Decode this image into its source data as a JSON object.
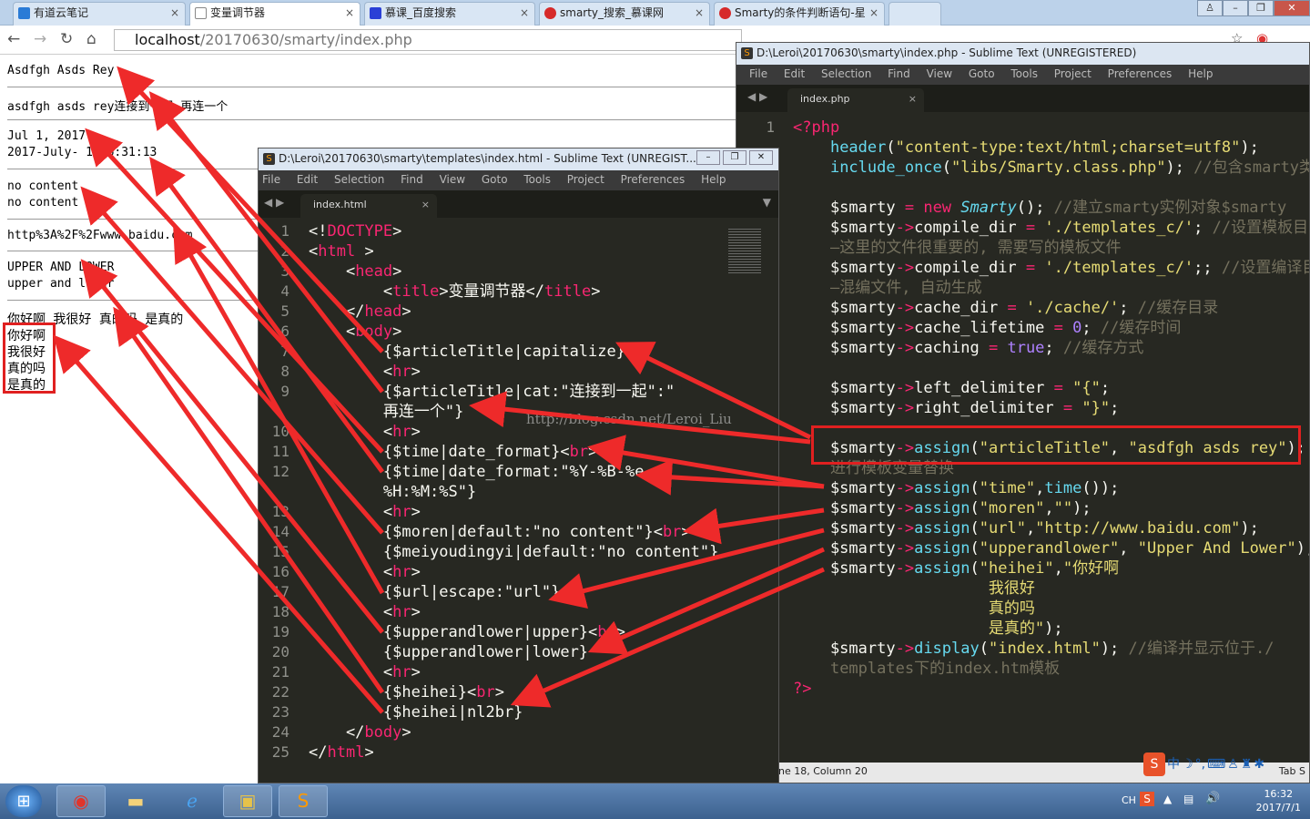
{
  "browser": {
    "tabs": [
      {
        "label": "有道云笔记",
        "color": "#2a7bd6"
      },
      {
        "label": "变量调节器",
        "color": "#ffffff"
      },
      {
        "label": "慕课_百度搜索",
        "color": "#2a3fd6"
      },
      {
        "label": "smarty_搜索_慕课网",
        "color": "#d62a2a"
      },
      {
        "label": "Smarty的条件判断语句-星",
        "color": "#d62a2a"
      }
    ],
    "url_host": "localhost",
    "url_path": "/20170630/smarty/index.php"
  },
  "page": {
    "lines": [
      "Asdfgh Asds Rey",
      "asdfgh asds rey连接到一起 再连一个",
      "Jul 1, 2017",
      "2017-July- 1 16:31:13",
      "no content",
      "no content",
      "http%3A%2F%2Fwww.baidu.com",
      "UPPER AND LOWER",
      "upper and lower",
      "你好啊 我很好 真的吗 是真的",
      "你好啊",
      "我很好",
      "真的吗",
      "是真的"
    ]
  },
  "editor_html": {
    "title": "D:\\Leroi\\20170630\\smarty\\templates\\index.html - Sublime Text (UNREGIST...",
    "menu": [
      "File",
      "Edit",
      "Selection",
      "Find",
      "View",
      "Goto",
      "Tools",
      "Project",
      "Preferences",
      "Help"
    ],
    "tab": "index.html",
    "tab_close": "×",
    "line_numbers": "1\n2\n3\n4\n5\n6\n7\n8\n9\n\n10\n11\n12\n\n13\n14\n15\n16\n17\n18\n19\n20\n21\n22\n23\n24\n25"
  },
  "editor_php": {
    "title": "D:\\Leroi\\20170630\\smarty\\index.php - Sublime Text (UNREGISTERED)",
    "menu": [
      "File",
      "Edit",
      "Selection",
      "Find",
      "View",
      "Goto",
      "Tools",
      "Project",
      "Preferences",
      "Help"
    ],
    "tab": "index.php",
    "tab_close": "×",
    "line_number": "1",
    "status": "ne 18, Column 20",
    "status_right": "Tab S"
  },
  "watermark": "http://blog.csdn.net/Leroi_Liu",
  "taskbar": {
    "lang": "CH",
    "time": "16:32",
    "date": "2017/7/1"
  },
  "colors": {
    "arrow": "#ee2a2a",
    "highlight_box": "#e02020",
    "editor_bg": "#272822"
  }
}
